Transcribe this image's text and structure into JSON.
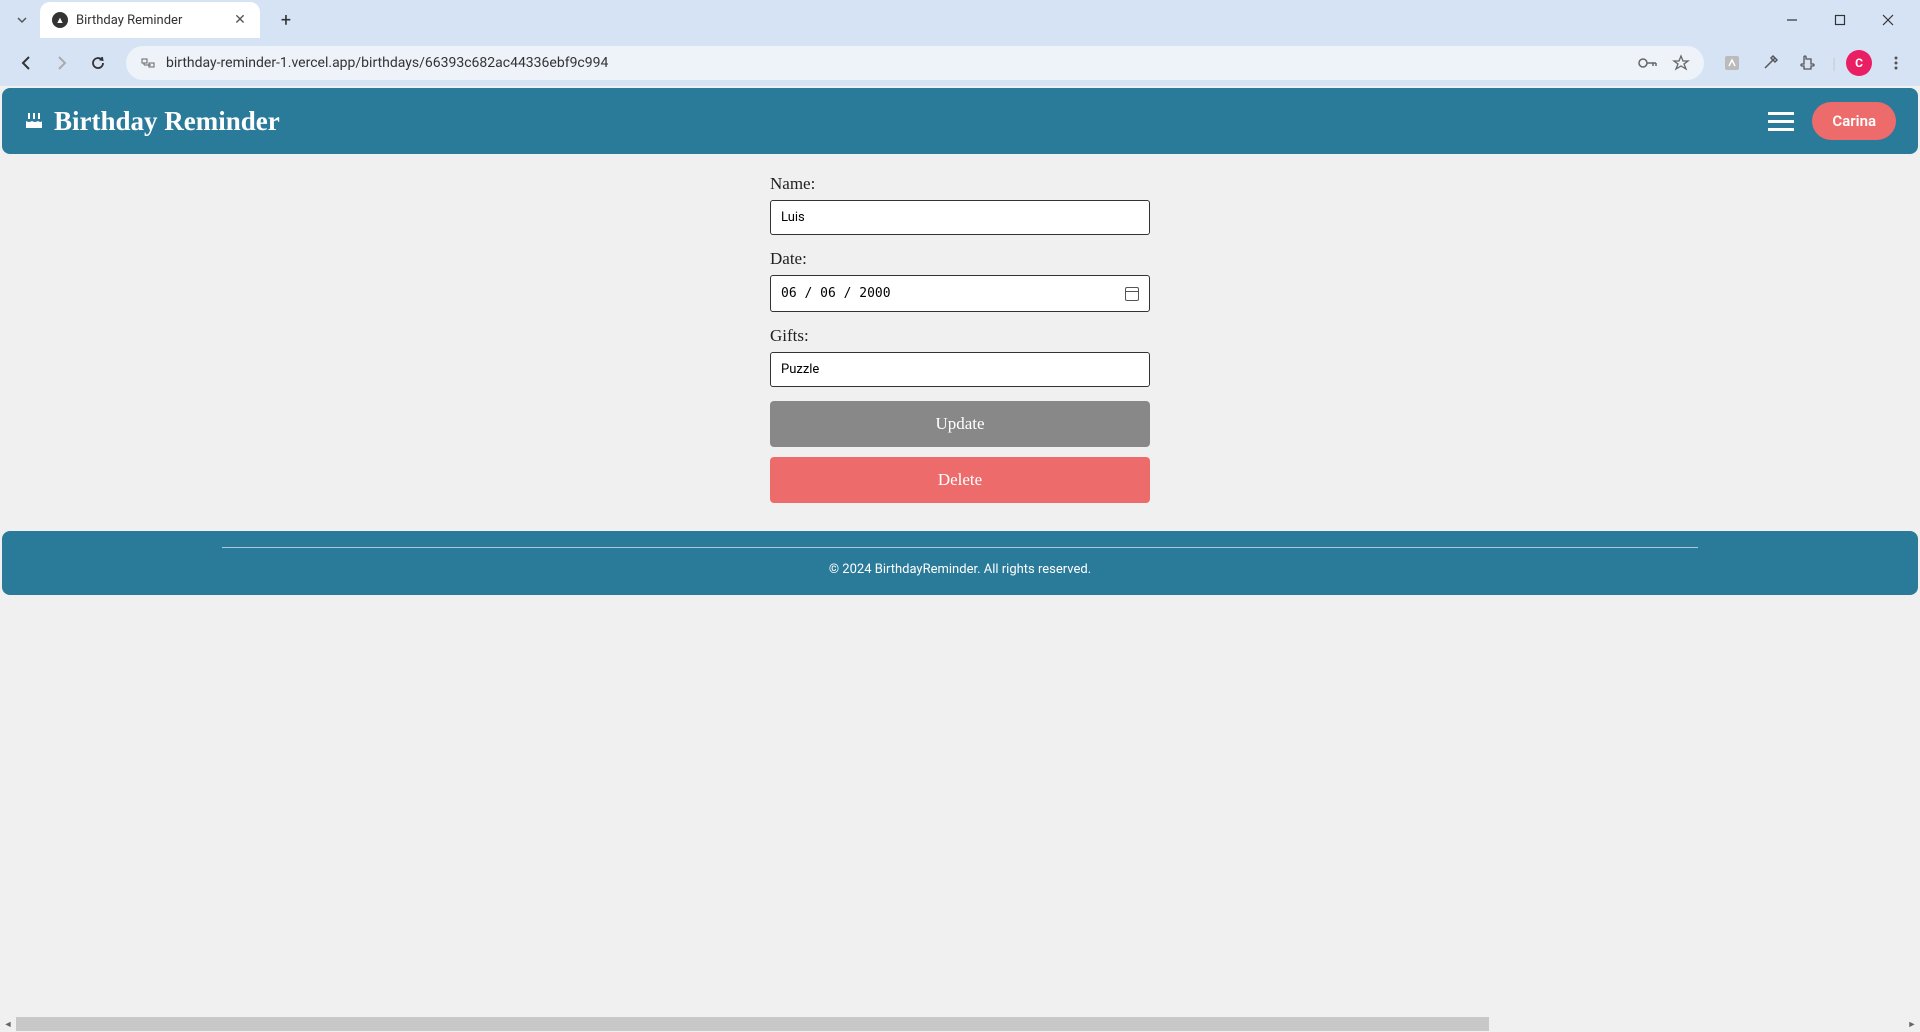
{
  "browser": {
    "tab_title": "Birthday Reminder",
    "url": "birthday-reminder-1.vercel.app/birthdays/66393c682ac44336ebf9c994",
    "profile_letter": "C"
  },
  "header": {
    "app_title": "Birthday Reminder",
    "user_name": "Carina"
  },
  "form": {
    "name_label": "Name:",
    "name_value": "Luis",
    "date_label": "Date:",
    "date_value": "06 / 06 / 2000",
    "gifts_label": "Gifts:",
    "gifts_value": "Puzzle",
    "update_button": "Update",
    "delete_button": "Delete"
  },
  "footer": {
    "copyright": "© 2024 BirthdayReminder. All rights reserved."
  }
}
